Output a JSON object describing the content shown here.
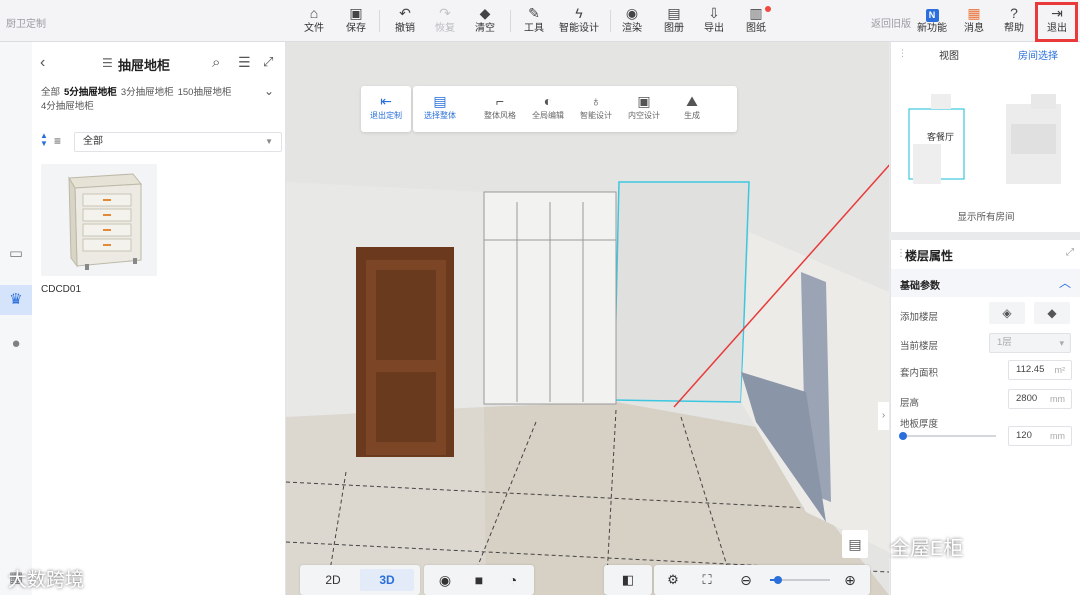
{
  "brand": "厨卫定制",
  "toolbar": {
    "file": "文件",
    "save": "保存",
    "undo": "撤销",
    "redo": "恢复",
    "clear": "清空",
    "tools": "工具",
    "smart": "智能设计",
    "render": "渲染",
    "album": "图册",
    "export": "导出",
    "drawings": "图纸",
    "back_old": "返回旧版",
    "new_feature": "新功能",
    "message": "消息",
    "help": "帮助",
    "exit": "退出"
  },
  "left_panel": {
    "title": "抽屉地柜",
    "categories": [
      "全部",
      "5分抽屉地柜",
      "3分抽屉地柜",
      "150抽屉地柜",
      "4分抽屉地柜"
    ],
    "active_category": "5分抽屉地柜",
    "filter_value": "全部",
    "product": {
      "name": "CDCD01"
    }
  },
  "subtoolbar": {
    "exit_custom": "退出定制",
    "select_whole": "选择整体",
    "whole_style": "整体风格",
    "global_edit": "全局编辑",
    "smart_design": "智能设计",
    "inner_design": "内空设计",
    "generate": "生成"
  },
  "bottombar": {
    "view2d": "2D",
    "view3d": "3D"
  },
  "right_top": {
    "tab_view": "视图",
    "tab_room": "房间选择",
    "room_label": "客餐厅",
    "show_all": "显示所有房间"
  },
  "floor_props": {
    "title": "楼层属性",
    "section": "基础参数",
    "add_floor": "添加楼层",
    "current_floor_label": "当前楼层",
    "current_floor_value": "1层",
    "area_label": "套内面积",
    "area_value": "112.45",
    "area_unit": "m²",
    "height_label": "层高",
    "height_value": "2800",
    "height_unit": "mm",
    "slab_label": "地板厚度",
    "slab_value": "120",
    "slab_unit": "mm"
  },
  "watermark": "全屋E柜",
  "watermark2": "大数跨境",
  "colors": {
    "accent": "#2a6fdb",
    "highlight_red": "#e83a3a",
    "cyan_outline": "#3cc7e0"
  }
}
